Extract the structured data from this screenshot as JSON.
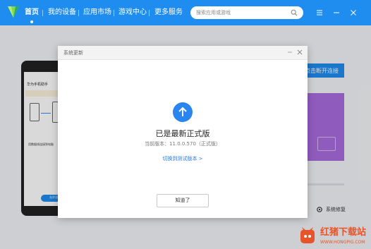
{
  "nav": {
    "items": [
      "首页",
      "我的设备",
      "应用市场",
      "游戏中心",
      "更多服务"
    ],
    "active_index": 0
  },
  "search": {
    "placeholder": "搜索应用或游戏"
  },
  "background": {
    "phone": {
      "title": "华为手机助手",
      "caption": "用数据线连接到电脑",
      "button_label": "允许访问"
    },
    "connect_button": "点击断开连接",
    "repair_label": "系统修复"
  },
  "dialog": {
    "title": "系统更新",
    "status_title": "已是最新正式版",
    "version_text": "当前版本：11.0.0.570（正式版）",
    "switch_link": "切换到测试版本 >",
    "ok_button": "知道了"
  },
  "watermark": {
    "title": "红猪下载站",
    "url": "WWW.HONGPIG.COM"
  },
  "colors": {
    "accent": "#1f8cf0",
    "link": "#2a7ae2",
    "promo": "#a96cde",
    "watermark": "#e8542a"
  },
  "icons": [
    "app-logo-icon",
    "search-icon",
    "minimize-icon",
    "close-icon",
    "update-arrow-icon",
    "gear-icon",
    "watermark-logo-icon"
  ]
}
